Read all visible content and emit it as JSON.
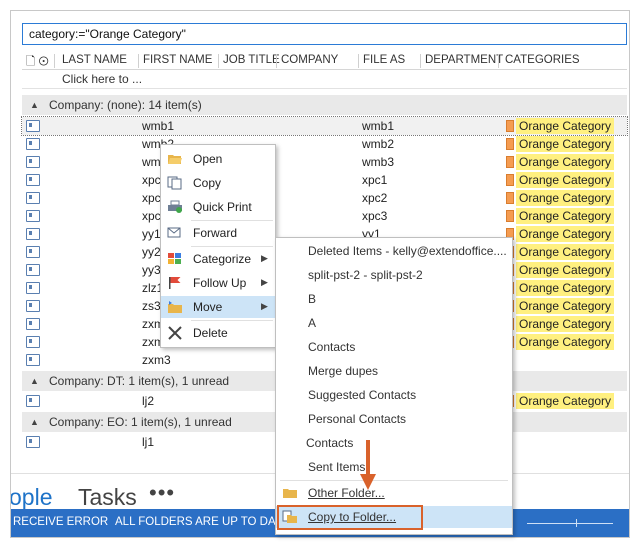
{
  "search": {
    "value": "category:=\"Orange Category\""
  },
  "columns": [
    "LAST NAME",
    "FIRST NAME",
    "JOB TITLE",
    "COMPANY",
    "FILE AS",
    "DEPARTMENT",
    "CATEGORIES"
  ],
  "click_here": "Click here to ...",
  "groups": [
    {
      "label": "Company: (none): 14 item(s)"
    },
    {
      "label": "Company: DT: 1 item(s), 1 unread"
    },
    {
      "label": "Company: EO: 1 item(s), 1 unread"
    }
  ],
  "rows": [
    {
      "first": "wmb1",
      "file_as": "wmb1",
      "category": "Orange Category"
    },
    {
      "first": "wmb2",
      "file_as": "wmb2",
      "category": "Orange Category"
    },
    {
      "first": "wm",
      "file_as": "wmb3",
      "category": "Orange Category"
    },
    {
      "first": "xpc",
      "file_as": "xpc1",
      "category": "Orange Category"
    },
    {
      "first": "xpc",
      "file_as": "xpc2",
      "category": "Orange Category"
    },
    {
      "first": "xpc",
      "file_as": "xpc3",
      "category": "Orange Category"
    },
    {
      "first": "yy1",
      "file_as": "yy1",
      "category": "Orange Category"
    },
    {
      "first": "yy2",
      "file_as": "",
      "category": "Orange Category"
    },
    {
      "first": "yy3",
      "file_as": "",
      "category": "Orange Category"
    },
    {
      "first": "zlz1",
      "file_as": "",
      "category": "Orange Category"
    },
    {
      "first": "zs3",
      "file_as": "",
      "category": "Orange Category"
    },
    {
      "first": "zxm",
      "file_as": "",
      "category": "Orange Category"
    },
    {
      "first": "zxm",
      "file_as": "",
      "category": "Orange Category"
    },
    {
      "first": "zxm3",
      "file_as": "",
      "category": ""
    },
    {
      "first": "lj2",
      "file_as": "",
      "category": "Orange Category"
    },
    {
      "first": "lj1",
      "file_as": "",
      "category": ""
    }
  ],
  "context_menu": {
    "open": "Open",
    "copy": "Copy",
    "quick_print": "Quick Print",
    "forward": "Forward",
    "categorize": "Categorize",
    "follow_up": "Follow Up",
    "move": "Move",
    "delete": "Delete"
  },
  "move_submenu": [
    "Deleted Items - kelly@extendoffice....",
    "split-pst-2 - split-pst-2",
    "B",
    "A",
    "Contacts",
    "Merge dupes",
    "Suggested Contacts",
    "Personal Contacts",
    "Contacts",
    "Sent Items",
    "Other Folder...",
    "Copy to Folder..."
  ],
  "nav": {
    "people": "ople",
    "tasks": "Tasks",
    "more": "•••"
  },
  "status": {
    "receive_error": "RECEIVE ERROR",
    "folders_status": "ALL FOLDERS ARE UP TO DATE."
  },
  "colors": {
    "accent": "#2b6fc5",
    "category_orange": "#f59c51",
    "category_highlight": "#fff080",
    "callout": "#d9622b"
  }
}
